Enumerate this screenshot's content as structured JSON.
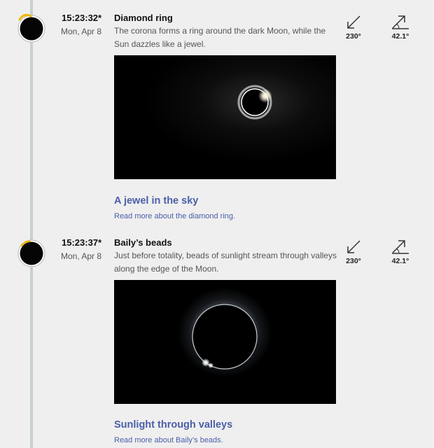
{
  "events": [
    {
      "time": "15:23:32*",
      "date": "Mon, Apr 8",
      "title": "Diamond ring",
      "description": "The corona forms a ring around the dark Moon, while the Sun dazzles like a jewel.",
      "card_title": "A jewel in the sky",
      "read_more": "Read more about the diamond ring.",
      "azimuth": "230°",
      "altitude": "42.1°"
    },
    {
      "time": "15:23:37*",
      "date": "Mon, Apr 8",
      "title": "Baily’s beads",
      "description": "Just before totality, beads of sunlight stream through valleys along the edge of the Moon.",
      "card_title": "Sunlight through valleys",
      "read_more": "Read more about Baily’s beads.",
      "azimuth": "230°",
      "altitude": "42.1°"
    }
  ],
  "icons": {
    "marker": "eclipse-phase-icon",
    "azimuth": "azimuth-arrow-icon",
    "altitude": "altitude-angle-icon"
  },
  "colors": {
    "link": "#4a5fa8",
    "timeline": "#c9d0d0",
    "sun_edge": "#f1b800"
  }
}
